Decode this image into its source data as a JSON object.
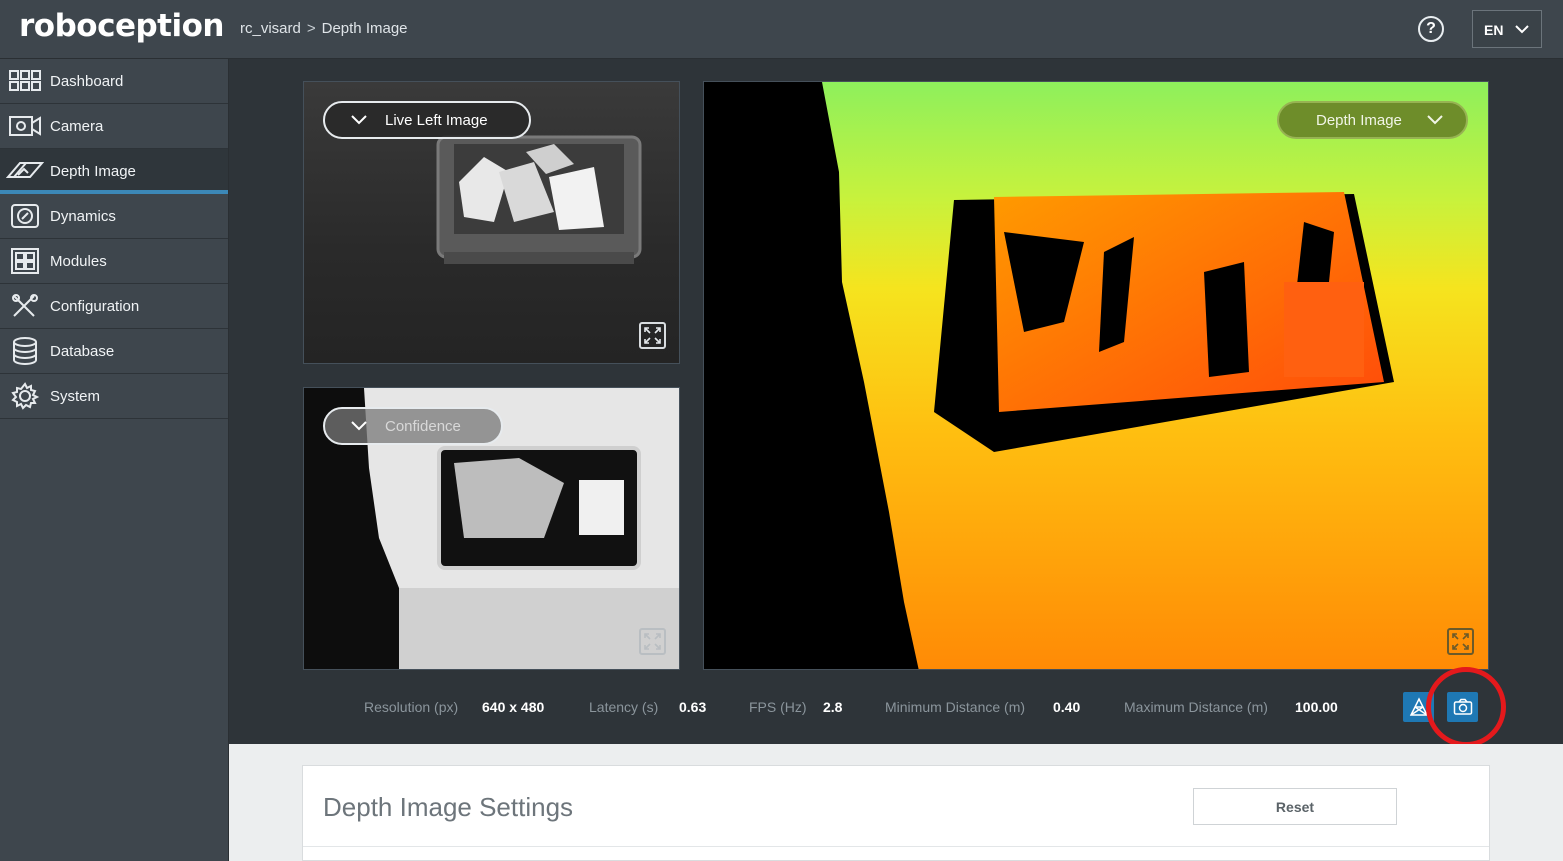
{
  "header": {
    "logo": "roboception",
    "breadcrumb": [
      "rc_visard",
      "Depth Image"
    ],
    "breadcrumb_sep": ">",
    "help_label": "?",
    "language": "EN"
  },
  "sidebar": {
    "items": [
      {
        "label": "Dashboard",
        "icon": "dashboard-icon"
      },
      {
        "label": "Camera",
        "icon": "camera-icon"
      },
      {
        "label": "Depth Image",
        "icon": "depth-image-icon",
        "active": true
      },
      {
        "label": "Dynamics",
        "icon": "dynamics-icon"
      },
      {
        "label": "Modules",
        "icon": "modules-icon"
      },
      {
        "label": "Configuration",
        "icon": "configuration-icon"
      },
      {
        "label": "Database",
        "icon": "database-icon"
      },
      {
        "label": "System",
        "icon": "system-icon"
      }
    ]
  },
  "views": {
    "live_select": "Live Left Image",
    "confidence_select": "Confidence",
    "depth_select": "Depth Image"
  },
  "stats": {
    "resolution_label": "Resolution (px)",
    "resolution_value": "640 x 480",
    "latency_label": "Latency (s)",
    "latency_value": "0.63",
    "fps_label": "FPS (Hz)",
    "fps_value": "2.8",
    "min_dist_label": "Minimum Distance (m)",
    "min_dist_value": "0.40",
    "max_dist_label": "Maximum Distance (m)",
    "max_dist_value": "100.00"
  },
  "settings": {
    "title": "Depth Image Settings",
    "reset_label": "Reset"
  },
  "colors": {
    "accent": "#1e78b4",
    "active_nav": "#3c88b7",
    "highlight": "#e4191c"
  }
}
